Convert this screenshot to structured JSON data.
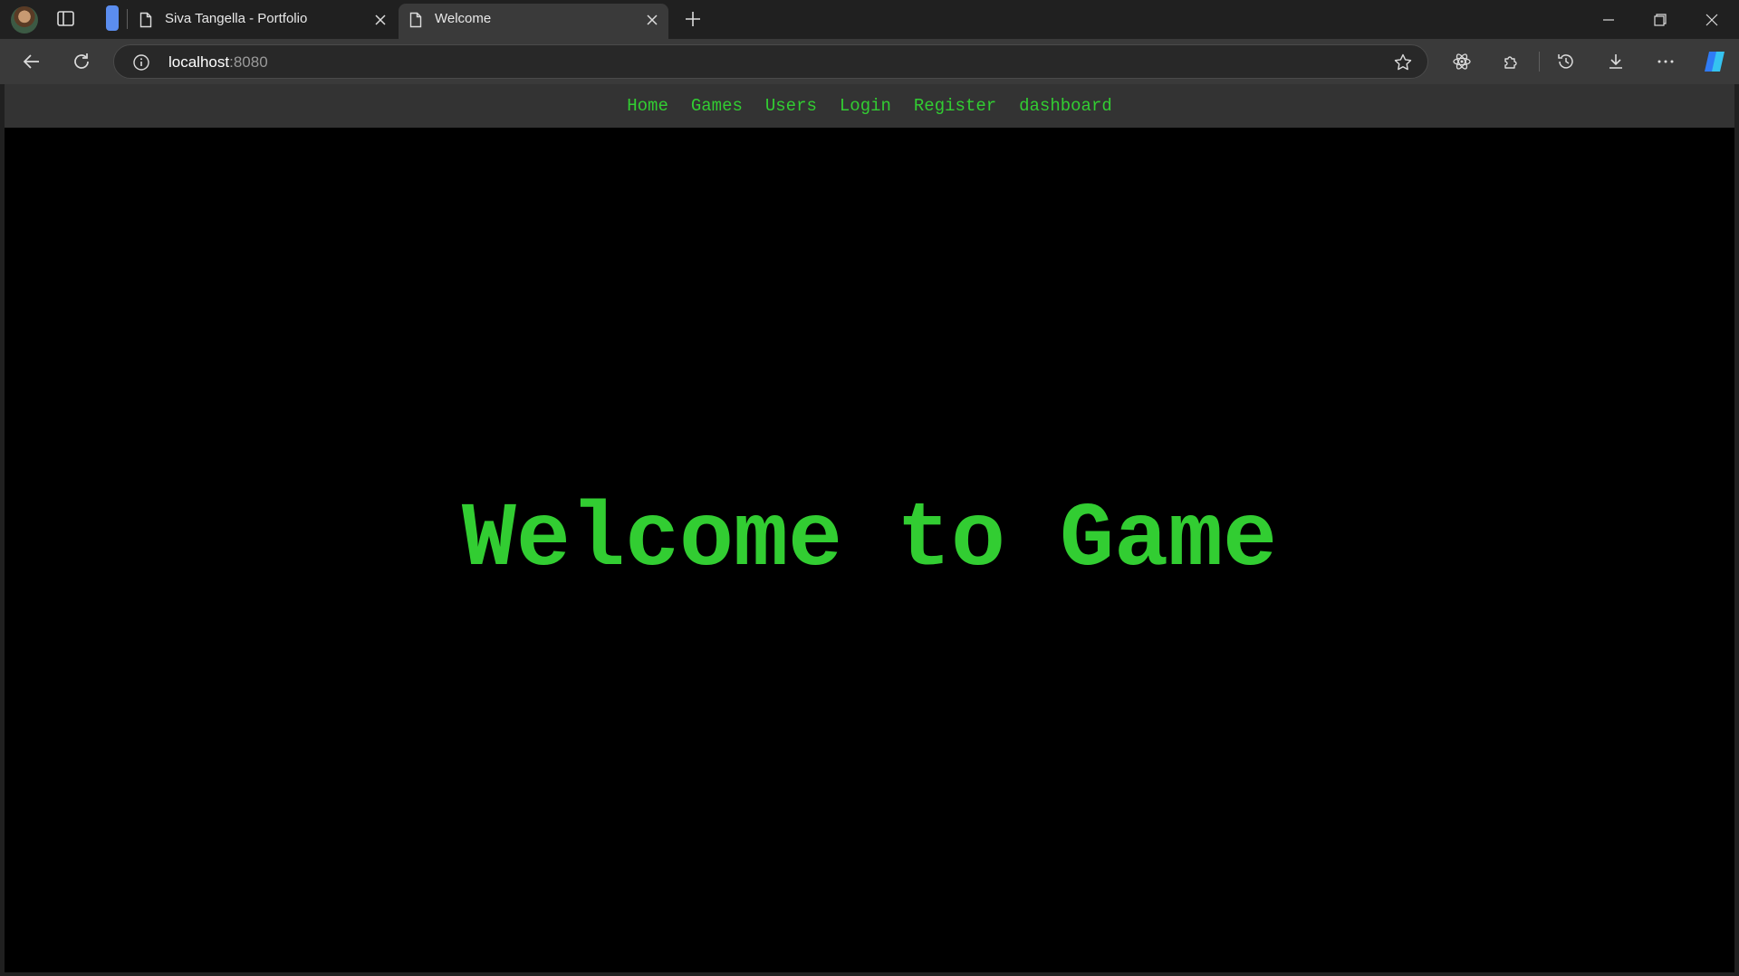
{
  "browser": {
    "tabs": [
      {
        "title": "Siva Tangella - Portfolio",
        "active": false
      },
      {
        "title": "Welcome",
        "active": true
      }
    ],
    "address": {
      "host": "localhost",
      "port": ":8080"
    }
  },
  "site": {
    "nav": [
      "Home",
      "Games",
      "Users",
      "Login",
      "Register",
      "dashboard"
    ],
    "headline": "Welcome to Game"
  },
  "colors": {
    "accent_green": "#32cd32",
    "page_background": "#000000",
    "nav_background": "#333333",
    "browser_chrome": "#202020"
  }
}
